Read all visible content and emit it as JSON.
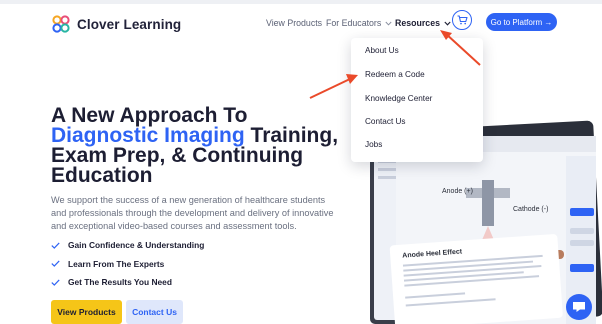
{
  "header": {
    "logo_text": "Clover Learning",
    "nav": {
      "view_products": "View Products",
      "for_educators": "For Educators",
      "resources": "Resources"
    },
    "cta_label": "Go to Platform →"
  },
  "resources_menu": {
    "items": [
      "About Us",
      "Redeem a Code",
      "Knowledge Center",
      "Contact Us",
      "Jobs"
    ]
  },
  "hero": {
    "headline_line1": "A New Approach To",
    "headline_blue": "Diagnostic Imaging",
    "headline_after_blue": " Training,",
    "headline_line3": "Exam Prep, & Continuing",
    "headline_line4": "Education",
    "subcopy": "We support the success of a new generation of healthcare students and professionals through the development and delivery of innovative and exceptional video-based courses and assessment tools.",
    "benefits": [
      "Gain Confidence & Understanding",
      "Learn From The Experts",
      "Get The Results You Need"
    ],
    "primary_button": "View Products",
    "secondary_button": "Contact Us"
  },
  "illustration": {
    "anode_label": "Anode (+)",
    "cathode_label": "Cathode (-)",
    "panel_title": "Anode Heel Effect"
  },
  "colors": {
    "brand_blue": "#2e63f4",
    "cta_yellow": "#f5c518",
    "annotation_red": "#ea4a2a"
  },
  "icons": {
    "cart": "cart-icon",
    "chat": "chat-bubble-icon",
    "check": "check-icon",
    "chevron": "chevron-down-icon"
  }
}
